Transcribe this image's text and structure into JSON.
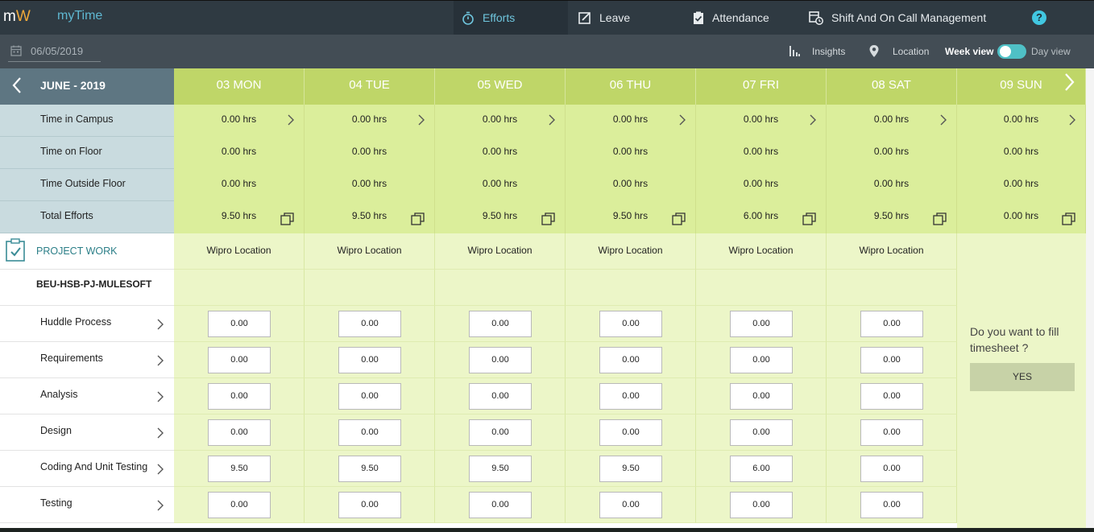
{
  "app": {
    "logo_m": "m",
    "logo_w": "W",
    "title": "myTime",
    "help": "?"
  },
  "nav": {
    "tabs": [
      {
        "label": "Efforts",
        "icon": "stopwatch-icon",
        "active": true
      },
      {
        "label": "Leave",
        "icon": "edit-icon",
        "active": false
      },
      {
        "label": "Attendance",
        "icon": "clipboard-check-icon",
        "active": false
      },
      {
        "label": "Shift And On Call Management",
        "icon": "calendar-clock-icon",
        "active": false
      }
    ]
  },
  "toolbar": {
    "date": "06/05/2019",
    "insights": "Insights",
    "location": "Location",
    "week_view": "Week view",
    "day_view": "Day view"
  },
  "grid": {
    "month": "JUNE - 2019",
    "days": [
      "03 MON",
      "04 TUE",
      "05 WED",
      "06 THU",
      "07 FRI",
      "08 SAT",
      "09 SUN"
    ],
    "summary": [
      {
        "label": "Time in Campus",
        "values": [
          "0.00 hrs",
          "0.00 hrs",
          "0.00 hrs",
          "0.00 hrs",
          "0.00 hrs",
          "0.00 hrs",
          "0.00 hrs"
        ]
      },
      {
        "label": "Time on Floor",
        "values": [
          "0.00 hrs",
          "0.00 hrs",
          "0.00 hrs",
          "0.00 hrs",
          "0.00 hrs",
          "0.00 hrs",
          "0.00 hrs"
        ]
      },
      {
        "label": "Time Outside Floor",
        "values": [
          "0.00 hrs",
          "0.00 hrs",
          "0.00 hrs",
          "0.00 hrs",
          "0.00 hrs",
          "0.00 hrs",
          "0.00 hrs"
        ]
      },
      {
        "label": "Total Efforts",
        "values": [
          "9.50 hrs",
          "9.50 hrs",
          "9.50 hrs",
          "9.50 hrs",
          "6.00 hrs",
          "9.50 hrs",
          "0.00 hrs"
        ]
      }
    ]
  },
  "project": {
    "section_label": "PROJECT WORK",
    "code": "BEU-HSB-PJ-MULESOFT",
    "locations": [
      "Wipro Location",
      "Wipro Location",
      "Wipro Location",
      "Wipro Location",
      "Wipro Location",
      "Wipro Location"
    ],
    "activities": [
      {
        "label": "Huddle Process",
        "hours": [
          "0.00",
          "0.00",
          "0.00",
          "0.00",
          "0.00",
          "0.00"
        ]
      },
      {
        "label": "Requirements",
        "hours": [
          "0.00",
          "0.00",
          "0.00",
          "0.00",
          "0.00",
          "0.00"
        ]
      },
      {
        "label": "Analysis",
        "hours": [
          "0.00",
          "0.00",
          "0.00",
          "0.00",
          "0.00",
          "0.00"
        ]
      },
      {
        "label": "Design",
        "hours": [
          "0.00",
          "0.00",
          "0.00",
          "0.00",
          "0.00",
          "0.00"
        ]
      },
      {
        "label": "Coding And Unit Testing",
        "hours": [
          "9.50",
          "9.50",
          "9.50",
          "9.50",
          "6.00",
          "0.00"
        ]
      },
      {
        "label": "Testing",
        "hours": [
          "0.00",
          "0.00",
          "0.00",
          "0.00",
          "0.00",
          "0.00"
        ]
      }
    ]
  },
  "sunday_prompt": {
    "question": "Do you want to fill timesheet ?",
    "yes_label": "YES"
  },
  "colors": {
    "nav_bg": "#2f3a42",
    "subbar_bg": "#434d55",
    "day_header": "#bfd668",
    "summary_cell": "#dbee9b",
    "project_cell": "#ecf6c8",
    "accent": "#6fc6de"
  }
}
